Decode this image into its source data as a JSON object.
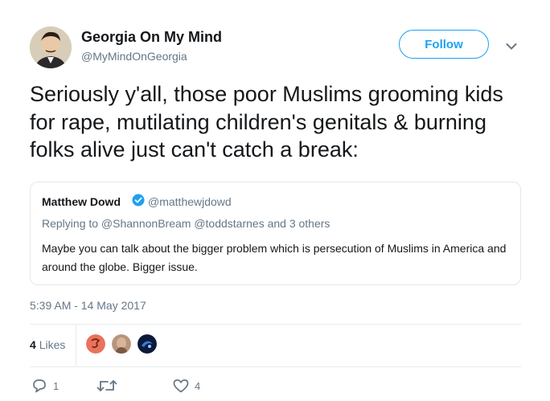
{
  "author": {
    "display_name": "Georgia On My Mind",
    "handle": "@MyMindOnGeorgia"
  },
  "follow_label": "Follow",
  "tweet_text": "Seriously y'all, those poor Muslims grooming kids for rape, mutilating children's genitals & burning folks alive just can't catch a break:",
  "quoted_tweet": {
    "name": "Matthew Dowd",
    "handle": "@matthewjdowd",
    "verified": true,
    "reply_context": "Replying to @ShannonBream @toddstarnes and 3 others",
    "text": "Maybe you can talk about the bigger problem which is persecution of Muslims in America and around the globe.  Bigger issue."
  },
  "timestamp": "5:39 AM - 14 May 2017",
  "likes": {
    "count": "4",
    "label": "Likes"
  },
  "actions": {
    "reply_count": "1",
    "retweet_count": "",
    "like_count": "4"
  },
  "icons": {
    "caret": "chevron-down-icon",
    "verified": "verified-badge-icon",
    "reply": "reply-icon",
    "retweet": "retweet-icon",
    "like": "heart-icon"
  },
  "colors": {
    "accent": "#1da1f2",
    "secondary_text": "#657786",
    "primary_text": "#14171a",
    "border": "#e1e8ed"
  }
}
